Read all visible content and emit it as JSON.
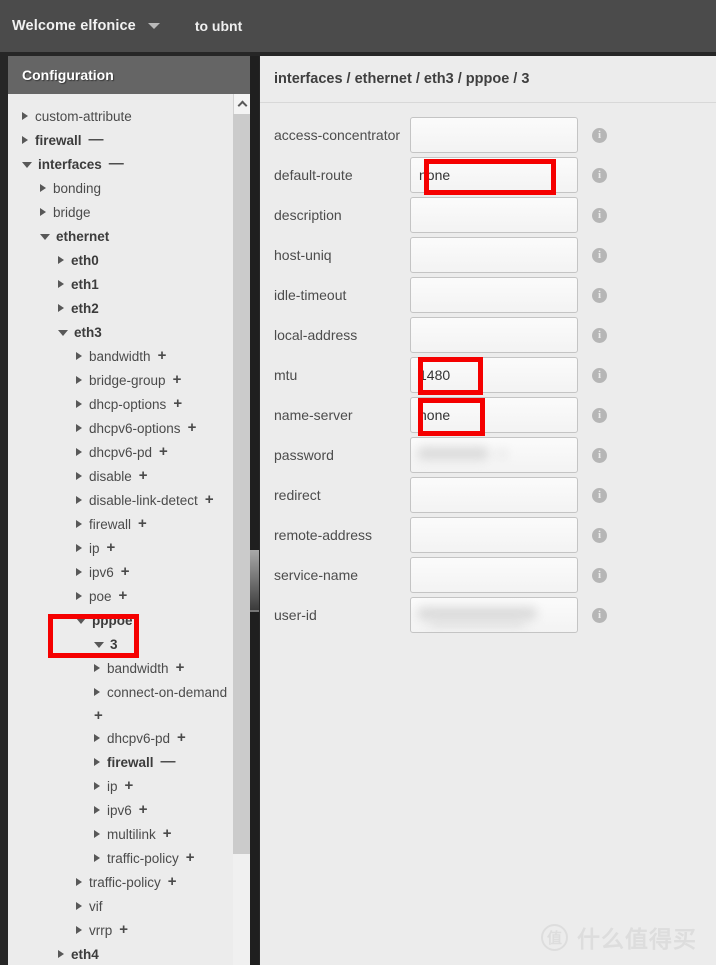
{
  "topbar": {
    "welcome": "Welcome elfonice",
    "dropdown_icon": "caret-down-icon",
    "to_label": "to ubnt"
  },
  "sidebar": {
    "header_title": "Configuration",
    "scroll_up_icon": "chevron-up-icon",
    "tree": [
      {
        "label": "custom-attribute",
        "depth": 0,
        "state": "collapsed",
        "bold": false,
        "sign": ""
      },
      {
        "label": "firewall",
        "depth": 0,
        "state": "collapsed",
        "bold": true,
        "sign": "—"
      },
      {
        "label": "interfaces",
        "depth": 0,
        "state": "open",
        "bold": true,
        "sign": "—"
      },
      {
        "label": "bonding",
        "depth": 1,
        "state": "collapsed",
        "bold": false,
        "sign": ""
      },
      {
        "label": "bridge",
        "depth": 1,
        "state": "collapsed",
        "bold": false,
        "sign": ""
      },
      {
        "label": "ethernet",
        "depth": 1,
        "state": "open",
        "bold": true,
        "sign": ""
      },
      {
        "label": "eth0",
        "depth": 2,
        "state": "collapsed",
        "bold": true,
        "sign": ""
      },
      {
        "label": "eth1",
        "depth": 2,
        "state": "collapsed",
        "bold": true,
        "sign": ""
      },
      {
        "label": "eth2",
        "depth": 2,
        "state": "collapsed",
        "bold": true,
        "sign": ""
      },
      {
        "label": "eth3",
        "depth": 2,
        "state": "open",
        "bold": true,
        "sign": ""
      },
      {
        "label": "bandwidth",
        "depth": 3,
        "state": "collapsed",
        "bold": false,
        "sign": "+"
      },
      {
        "label": "bridge-group",
        "depth": 3,
        "state": "collapsed",
        "bold": false,
        "sign": "+"
      },
      {
        "label": "dhcp-options",
        "depth": 3,
        "state": "collapsed",
        "bold": false,
        "sign": "+"
      },
      {
        "label": "dhcpv6-options",
        "depth": 3,
        "state": "collapsed",
        "bold": false,
        "sign": "+"
      },
      {
        "label": "dhcpv6-pd",
        "depth": 3,
        "state": "collapsed",
        "bold": false,
        "sign": "+"
      },
      {
        "label": "disable",
        "depth": 3,
        "state": "collapsed",
        "bold": false,
        "sign": "+"
      },
      {
        "label": "disable-link-detect",
        "depth": 3,
        "state": "collapsed",
        "bold": false,
        "sign": "+"
      },
      {
        "label": "firewall",
        "depth": 3,
        "state": "collapsed",
        "bold": false,
        "sign": "+"
      },
      {
        "label": "ip",
        "depth": 3,
        "state": "collapsed",
        "bold": false,
        "sign": "+"
      },
      {
        "label": "ipv6",
        "depth": 3,
        "state": "collapsed",
        "bold": false,
        "sign": "+"
      },
      {
        "label": "poe",
        "depth": 3,
        "state": "collapsed",
        "bold": false,
        "sign": "+"
      },
      {
        "label": "pppoe",
        "depth": 3,
        "state": "open",
        "bold": true,
        "sign": ""
      },
      {
        "label": "3",
        "depth": 4,
        "state": "open",
        "bold": true,
        "sign": ""
      },
      {
        "label": "bandwidth",
        "depth": 5,
        "state": "collapsed",
        "bold": false,
        "sign": "+"
      },
      {
        "label": "connect-on-demand",
        "depth": 5,
        "state": "collapsed",
        "bold": false,
        "sign": "",
        "wrap_plus": "+"
      },
      {
        "label": "dhcpv6-pd",
        "depth": 5,
        "state": "collapsed",
        "bold": false,
        "sign": "+"
      },
      {
        "label": "firewall",
        "depth": 5,
        "state": "collapsed",
        "bold": true,
        "sign": "—"
      },
      {
        "label": "ip",
        "depth": 5,
        "state": "collapsed",
        "bold": false,
        "sign": "+"
      },
      {
        "label": "ipv6",
        "depth": 5,
        "state": "collapsed",
        "bold": false,
        "sign": "+"
      },
      {
        "label": "multilink",
        "depth": 5,
        "state": "collapsed",
        "bold": false,
        "sign": "+"
      },
      {
        "label": "traffic-policy",
        "depth": 5,
        "state": "collapsed",
        "bold": false,
        "sign": "+"
      },
      {
        "label": "traffic-policy",
        "depth": 3,
        "state": "collapsed",
        "bold": false,
        "sign": "+"
      },
      {
        "label": "vif",
        "depth": 3,
        "state": "collapsed",
        "bold": false,
        "sign": ""
      },
      {
        "label": "vrrp",
        "depth": 3,
        "state": "collapsed",
        "bold": false,
        "sign": "+"
      },
      {
        "label": "eth4",
        "depth": 2,
        "state": "collapsed",
        "bold": true,
        "sign": ""
      }
    ]
  },
  "main": {
    "breadcrumb": "interfaces / ethernet / eth3 / pppoe / 3",
    "fields": [
      {
        "label": "access-concentrator",
        "value": "",
        "blurred": false,
        "info": "info-icon"
      },
      {
        "label": "default-route",
        "value": "none",
        "blurred": false,
        "info": "info-icon"
      },
      {
        "label": "description",
        "value": "",
        "blurred": false,
        "info": "info-icon"
      },
      {
        "label": "host-uniq",
        "value": "",
        "blurred": false,
        "info": "info-icon"
      },
      {
        "label": "idle-timeout",
        "value": "",
        "blurred": false,
        "info": "info-icon"
      },
      {
        "label": "local-address",
        "value": "",
        "blurred": false,
        "info": "info-icon"
      },
      {
        "label": "mtu",
        "value": "1480",
        "blurred": false,
        "info": "info-icon"
      },
      {
        "label": "name-server",
        "value": "none",
        "blurred": false,
        "info": "info-icon"
      },
      {
        "label": "password",
        "value": "",
        "blurred": true,
        "info": "info-icon"
      },
      {
        "label": "redirect",
        "value": "",
        "blurred": false,
        "info": "info-icon"
      },
      {
        "label": "remote-address",
        "value": "",
        "blurred": false,
        "info": "info-icon"
      },
      {
        "label": "service-name",
        "value": "",
        "blurred": false,
        "info": "info-icon"
      },
      {
        "label": "user-id",
        "value": "",
        "blurred": true,
        "info": "info-icon"
      }
    ]
  },
  "annotations": {
    "color": "#f50000",
    "boxes": [
      "default-route-value",
      "mtu-value",
      "name-server-value",
      "pppoe-node"
    ]
  },
  "watermark": {
    "logo_char": "值",
    "text": "什么值得买"
  }
}
